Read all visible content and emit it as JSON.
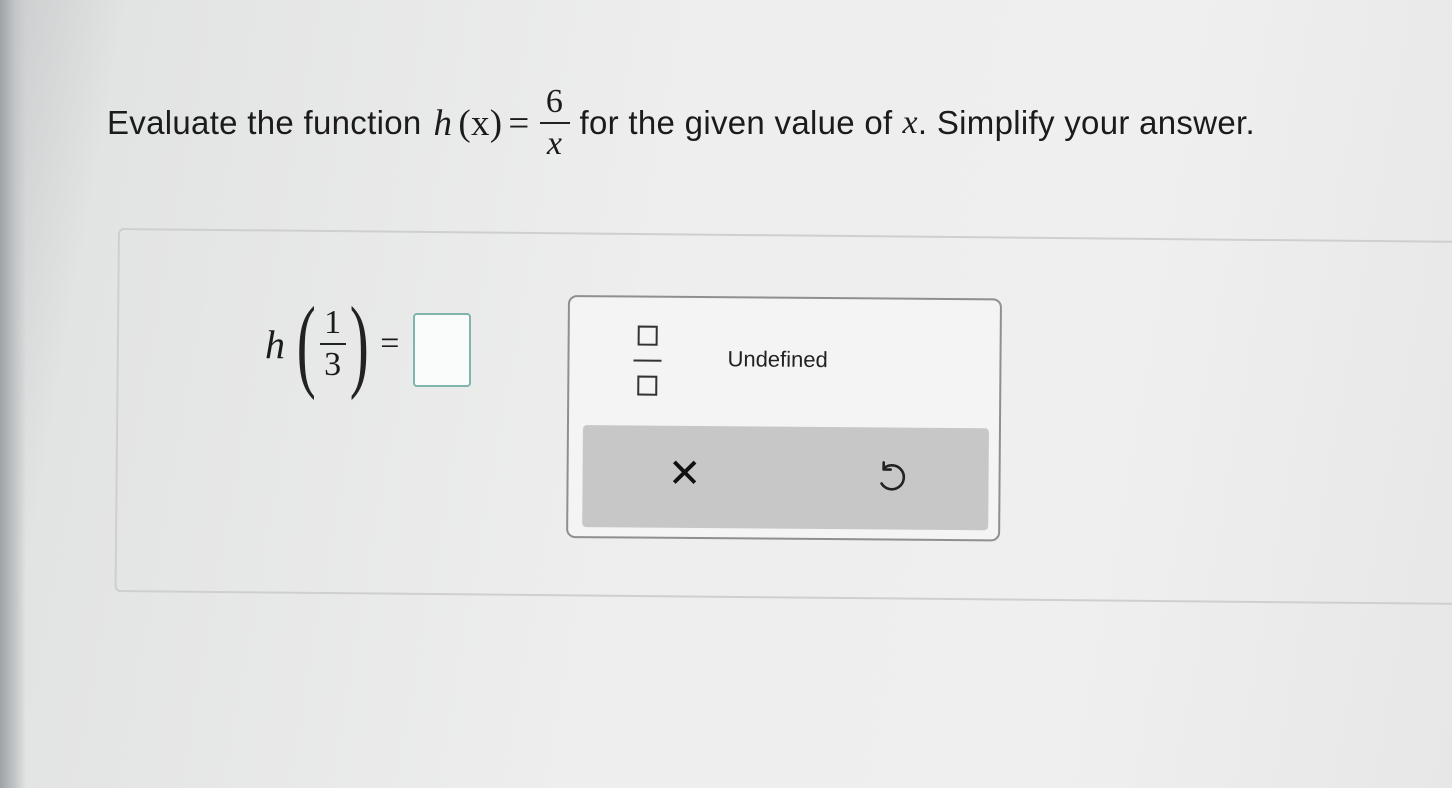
{
  "question": {
    "prefix": "Evaluate the function",
    "func_name": "h",
    "func_arg": "(x)",
    "equals": "=",
    "numerator": "6",
    "denominator": "x",
    "middle": "for the given value of",
    "var": "x",
    "suffix": ". Simplify your answer."
  },
  "equation": {
    "func_name": "h",
    "left_paren": "(",
    "numerator": "1",
    "denominator": "3",
    "right_paren": ")",
    "equals": "="
  },
  "answer_input": {
    "value": ""
  },
  "palette": {
    "fraction_icon": "fraction-template-icon",
    "undefined_label": "Undefined",
    "clear_icon": "close-icon",
    "clear_glyph": "✕",
    "undo_icon": "undo-icon"
  }
}
